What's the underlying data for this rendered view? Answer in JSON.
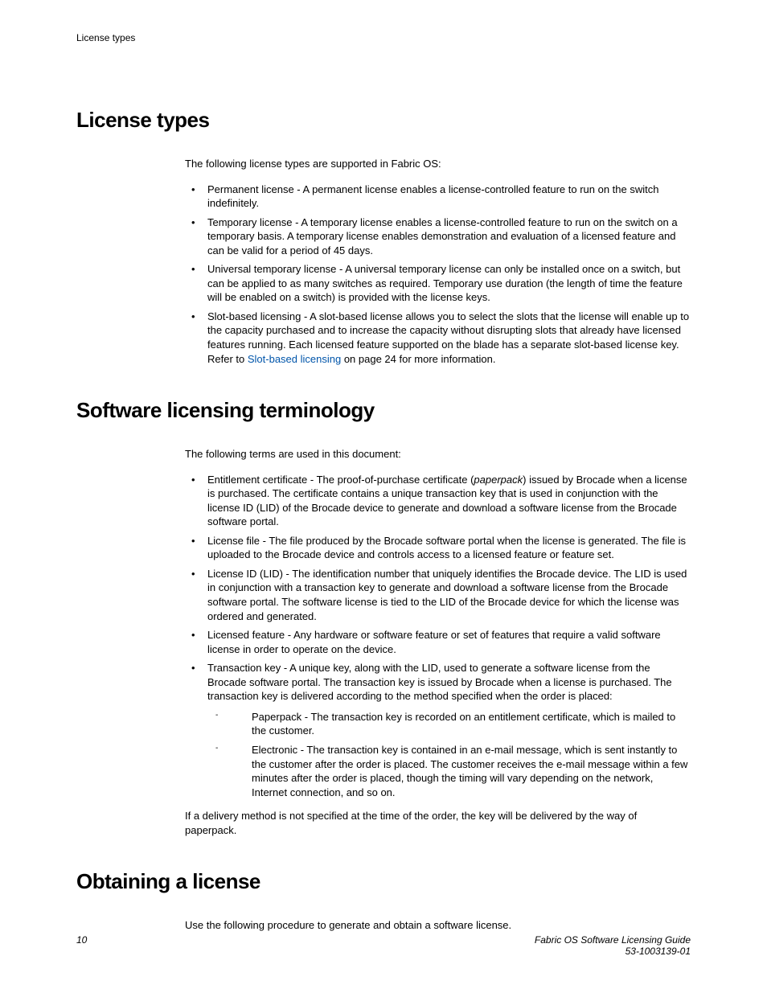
{
  "header_label": "License types",
  "sections": {
    "license_types": {
      "title": "License types",
      "intro": "The following license types are supported in Fabric OS:",
      "items": {
        "permanent": "Permanent license - A permanent license enables a license-controlled feature to run on the switch indefinitely.",
        "temporary": "Temporary license - A temporary license enables a license-controlled feature to run on the switch on a temporary basis. A temporary license enables demonstration and evaluation of a licensed feature and can be valid for a period of 45 days.",
        "universal": "Universal temporary license - A universal temporary license can only be installed once on a switch, but can be applied to as many switches as required. Temporary use duration (the length of time the feature will be enabled on a switch) is provided with the license keys.",
        "slot_pre": "Slot-based licensing - A slot-based license allows you to select the slots that the license will enable up to the capacity purchased and to increase the capacity without disrupting slots that already have licensed features running. Each licensed feature supported on the blade has a separate slot-based license key. Refer to ",
        "slot_link": "Slot-based licensing",
        "slot_post": " on page 24 for more information."
      }
    },
    "terminology": {
      "title": "Software licensing terminology",
      "intro": "The following terms are used in this document:",
      "items": {
        "entitlement_pre": "Entitlement certificate - The proof-of-purchase certificate (",
        "entitlement_it": "paperpack",
        "entitlement_post": ") issued by Brocade when a license is purchased. The certificate contains a unique transaction key that is used in conjunction with the license ID (LID) of the Brocade device to generate and download a software license from the Brocade software portal.",
        "file": "License file - The file produced by the Brocade software portal when the license is generated. The file is uploaded to the Brocade device and controls access to a licensed feature or feature set.",
        "lid": "License ID (LID) - The identification number that uniquely identifies the Brocade device. The LID is used in conjunction with a transaction key to generate and download a software license from the Brocade software portal. The software license is tied to the LID of the Brocade device for which the license was ordered and generated.",
        "feature": "Licensed feature - Any hardware or software feature or set of features that require a valid software license in order to operate on the device.",
        "transkey": "Transaction key - A unique key, along with the LID, used to generate a software license from the Brocade software portal. The transaction key is issued by Brocade when a license is purchased. The transaction key is delivered according to the method specified when the order is placed:",
        "paperpack": "Paperpack - The transaction key is recorded on an entitlement certificate, which is mailed to the customer.",
        "electronic": "Electronic - The transaction key is contained in an e-mail message, which is sent instantly to the customer after the order is placed. The customer receives the e-mail message within a few minutes after the order is placed, though the timing will vary depending on the network, Internet connection, and so on."
      },
      "after": "If a delivery method is not specified at the time of the order, the key will be delivered by the way of paperpack."
    },
    "obtaining": {
      "title": "Obtaining a license",
      "intro": "Use the following procedure to generate and obtain a software license."
    }
  },
  "footer": {
    "page": "10",
    "doc_title": "Fabric OS Software Licensing Guide",
    "doc_num": "53-1003139-01"
  }
}
